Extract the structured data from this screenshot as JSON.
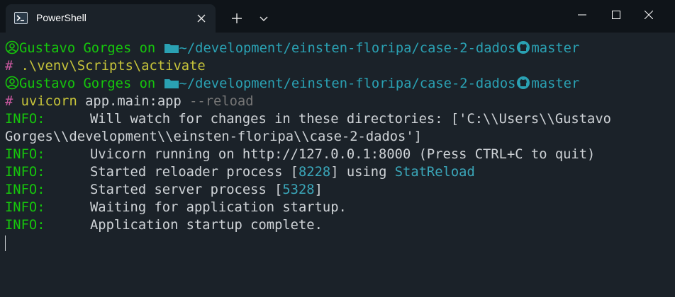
{
  "window": {
    "tab_title": "PowerShell",
    "icons": [
      "powershell-icon",
      "close-icon",
      "plus-icon",
      "chevron-down-icon",
      "minimize-icon",
      "maximize-icon",
      "window-close-icon"
    ]
  },
  "terminal": {
    "prompt1": {
      "user": "Gustavo Gorges",
      "on": " on ",
      "path": "~/development/einsten-floripa/case-2-dados",
      "branch": "master",
      "hash": "#",
      "command": " .\\venv\\Scripts\\activate"
    },
    "prompt2": {
      "user": "Gustavo Gorges",
      "on": " on ",
      "path": "~/development/einsten-floripa/case-2-dados",
      "branch": "master",
      "hash": "#",
      "cmd_name": " uvicorn",
      "cmd_args": " app.main:app",
      "cmd_flag": " --reload"
    },
    "output": {
      "info_label": "INFO:",
      "watch_line1": "Will watch for changes in these directories: ['C:\\\\Users\\\\Gustavo",
      "watch_line2": "Gorges\\\\development\\\\einsten-floripa\\\\case-2-dados']",
      "running": "Uvicorn running on http://127.0.0.1:8000 (Press CTRL+C to quit)",
      "reloader_pre": "Started reloader process [",
      "reloader_pid": "8228",
      "reloader_mid": "] using ",
      "reloader_name": "StatReload",
      "server_pre": "Started server process [",
      "server_pid": "5328",
      "server_post": "]",
      "waiting": "Waiting for application startup.",
      "complete": "Application startup complete."
    }
  }
}
